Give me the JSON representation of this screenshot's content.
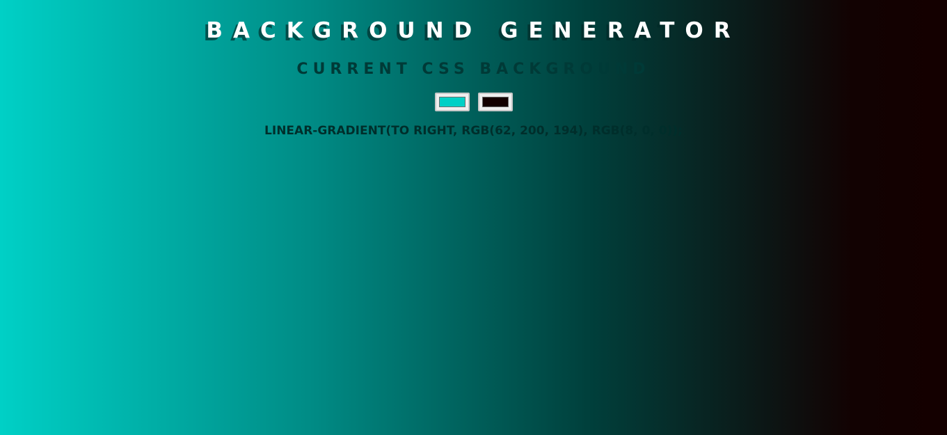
{
  "header": {
    "title": "BACKGROUND GENERATOR",
    "subtitle": "CURRENT CSS BACKGROUND"
  },
  "color_inputs": [
    {
      "value": "#00d0c6"
    },
    {
      "value": "#140000"
    }
  ],
  "css_output": {
    "text": "LINEAR-GRADIENT(TO RIGHT, RGB(62, 200, 194), RGB(8, 0, 0));"
  },
  "colors": {
    "gradient_start": "#00d0c6",
    "gradient_end": "#140000",
    "title_text": "#ffffff",
    "subtitle_text": "#003a37",
    "output_text": "#002e2b"
  }
}
